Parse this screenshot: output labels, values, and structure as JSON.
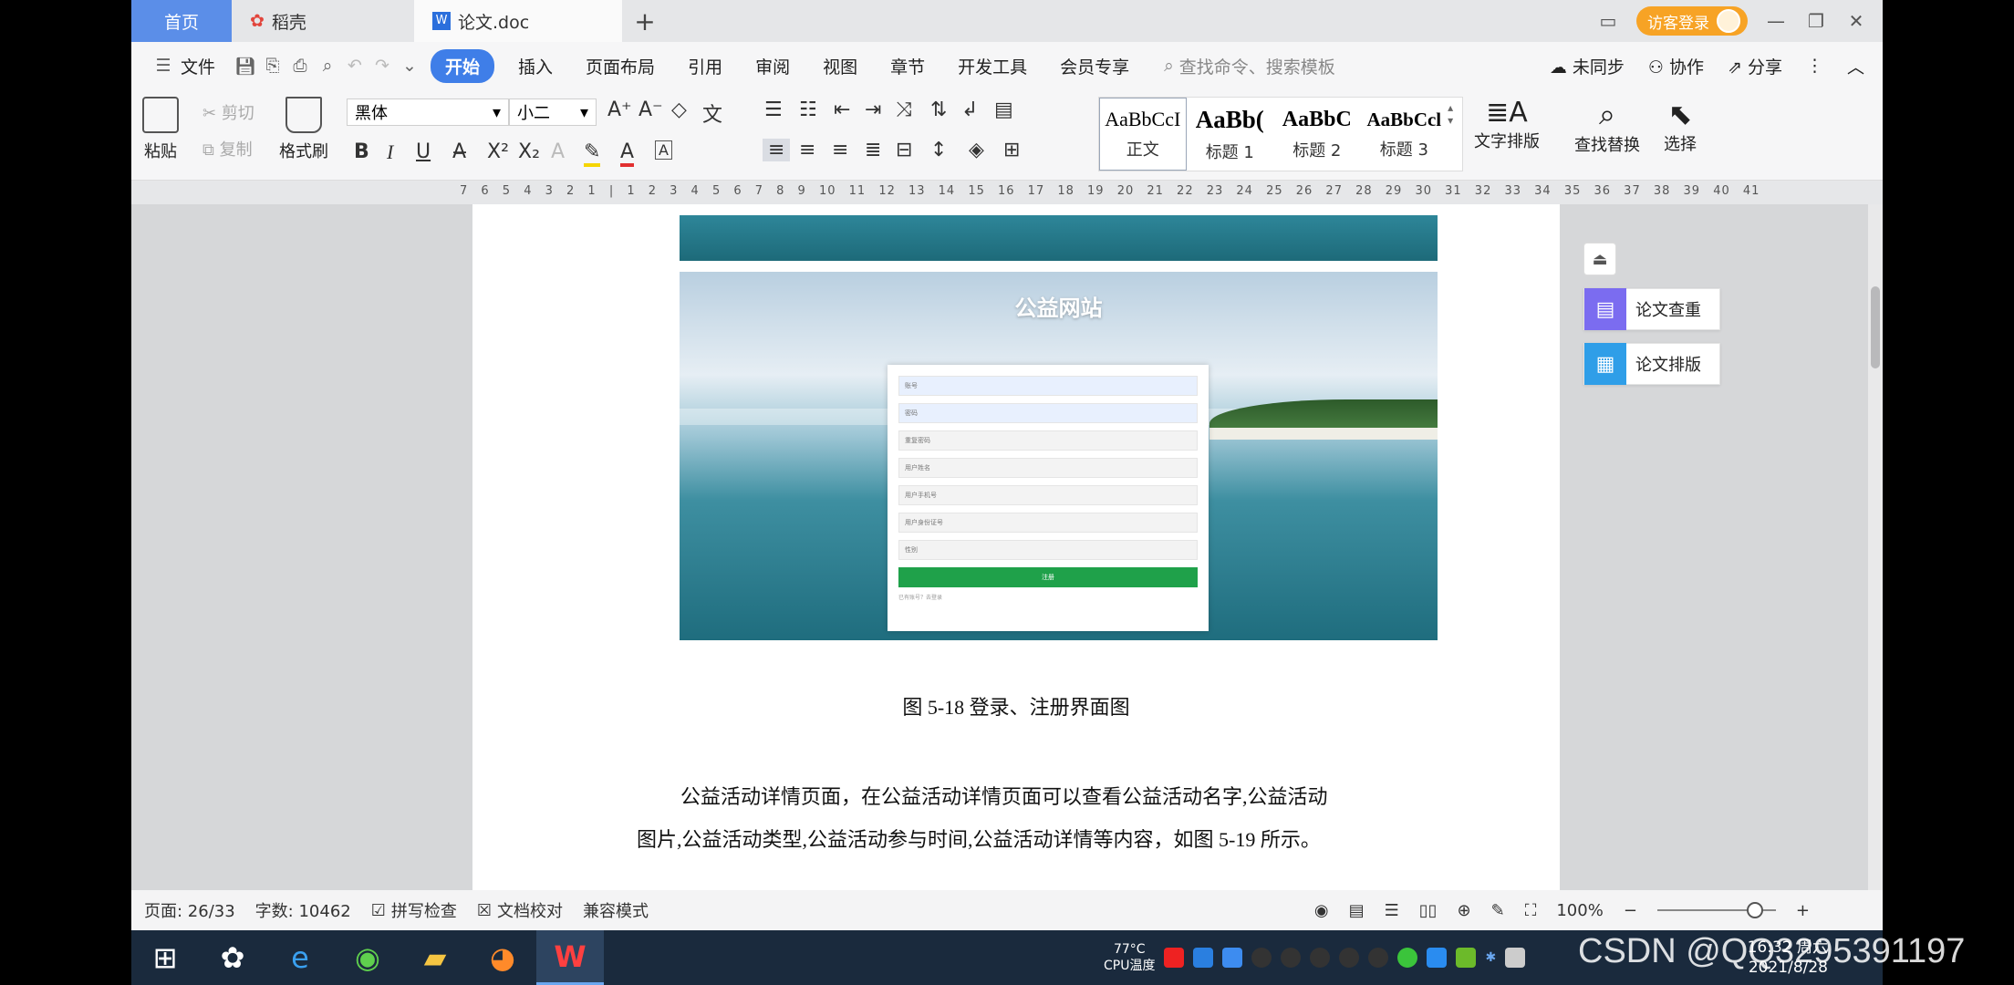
{
  "tabs": {
    "home": "首页",
    "daoke": "稻壳",
    "doc": "论文.doc",
    "add": "+"
  },
  "titlebar": {
    "login": "访客登录",
    "minimize": "—",
    "restore": "❐",
    "close": "✕"
  },
  "menu": {
    "file": "文件",
    "items": [
      "开始",
      "插入",
      "页面布局",
      "引用",
      "审阅",
      "视图",
      "章节",
      "开发工具",
      "会员专享"
    ],
    "search_placeholder": "查找命令、搜索模板",
    "unsync": "未同步",
    "collab": "协作",
    "share": "分享"
  },
  "ribbon": {
    "paste": "粘贴",
    "cut": "剪切",
    "copy": "复制",
    "format_painter": "格式刷",
    "font_name": "黑体",
    "font_size": "小二",
    "styles": [
      {
        "sample": "AaBbCcI",
        "name": "正文",
        "bold": false
      },
      {
        "sample": "AaBb(",
        "name": "标题 1",
        "bold": true
      },
      {
        "sample": "AaBbC",
        "name": "标题 2",
        "bold": true
      },
      {
        "sample": "AaBbCcl",
        "name": "标题 3",
        "bold": true
      }
    ],
    "text_layout": "文字排版",
    "find_replace": "查找替换",
    "select": "选择"
  },
  "ruler": "7 6 5 4 3 2 1 | 1 2 3 4 5 6 7 8 9 10 11 12 13 14 15 16 17 18 19 20 21 22 23 24 25 26 27 28 29 30 31 32 33 34 35 36 37 38 39 40 41",
  "figure": {
    "site_title": "公益网站",
    "fields": [
      "账号",
      "密码",
      "重复密码",
      "用户姓名",
      "用户手机号",
      "用户身份证号",
      "性别"
    ],
    "submit": "注册",
    "note": "已有账号？去登录"
  },
  "document": {
    "caption": "图 5-18 登录、注册界面图",
    "para_line1": "公益活动详情页面，在公益活动详情页面可以查看公益活动名字,公益活动",
    "para_line2": "图片,公益活动类型,公益活动参与时间,公益活动详情等内容，如图 5-19 所示。"
  },
  "float_panel": {
    "check": "论文查重",
    "layout": "论文排版"
  },
  "status": {
    "page": "页面: 26/33",
    "words": "字数: 10462",
    "spell": "拼写检查",
    "proof": "文档校对",
    "compat": "兼容模式",
    "zoom": "100%"
  },
  "taskbar": {
    "temp": "77°C",
    "cpu": "CPU温度",
    "time": "16:32 周六",
    "date": "2021/8/28"
  },
  "watermark": "CSDN @QQ3295391197"
}
